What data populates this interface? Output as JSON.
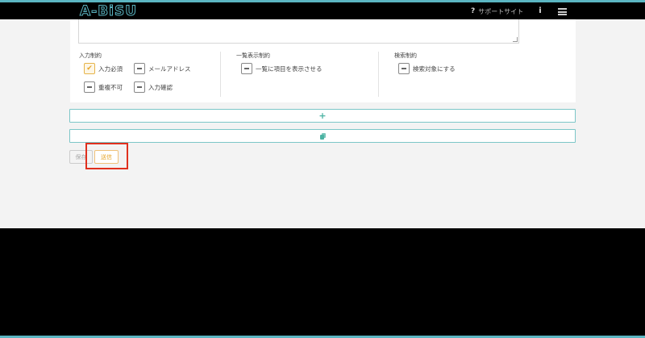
{
  "header": {
    "logo": "A-BiSU",
    "support_icon_glyph": "?",
    "support_label": "サポートサイト",
    "info_icon_glyph": "i",
    "icons": {
      "support": "question-icon",
      "info": "info-icon",
      "menu": "hamburger-menu-icon"
    }
  },
  "constraints": {
    "input": {
      "label": "入力制約",
      "options": [
        {
          "label": "入力必須",
          "checked": true
        },
        {
          "label": "メールアドレス",
          "checked": false
        },
        {
          "label": "重複不可",
          "checked": false
        },
        {
          "label": "入力確認",
          "checked": false
        }
      ]
    },
    "list": {
      "label": "一覧表示制約",
      "options": [
        {
          "label": "一覧に項目を表示させる",
          "checked": false
        }
      ]
    },
    "search": {
      "label": "検索制約",
      "options": [
        {
          "label": "検索対象にする",
          "checked": false
        }
      ]
    }
  },
  "actions": {
    "add_glyph": "+",
    "save_label": "保存",
    "send_label": "送信"
  },
  "colors": {
    "accent": "#5bb5c2",
    "highlight": "#e0301e",
    "send": "#e6a52a"
  }
}
